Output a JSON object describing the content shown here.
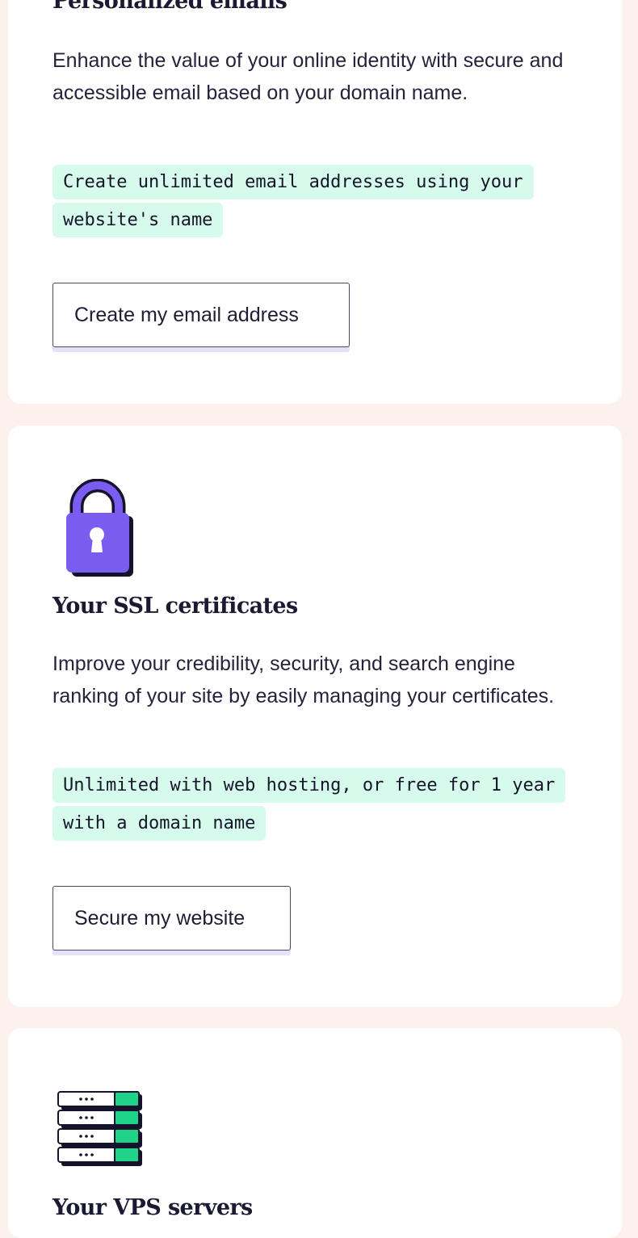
{
  "email_card": {
    "title": "Personalized emails",
    "description": "Enhance the value of your online identity with secure and accessible email based on your domain name.",
    "highlight": "Create unlimited email addresses using your website's name",
    "button_label": "Create my email address"
  },
  "ssl_card": {
    "icon": "padlock-icon",
    "title": "Your SSL certificates",
    "description": "Improve your credibility, security, and search engine ranking of your site by easily managing your certificates.",
    "highlight": "Unlimited with web hosting, or free for 1 year with a domain name",
    "button_label": "Secure my website"
  },
  "vps_card": {
    "icon": "server-stack-icon",
    "title": "Your VPS servers"
  },
  "colors": {
    "page_background": "#fdf1ee",
    "card_background": "#ffffff",
    "highlight_background": "#d6fbec",
    "padlock_purple": "#7b5cf0",
    "server_green": "#1fd388",
    "button_shadow": "#e5e2f7"
  }
}
